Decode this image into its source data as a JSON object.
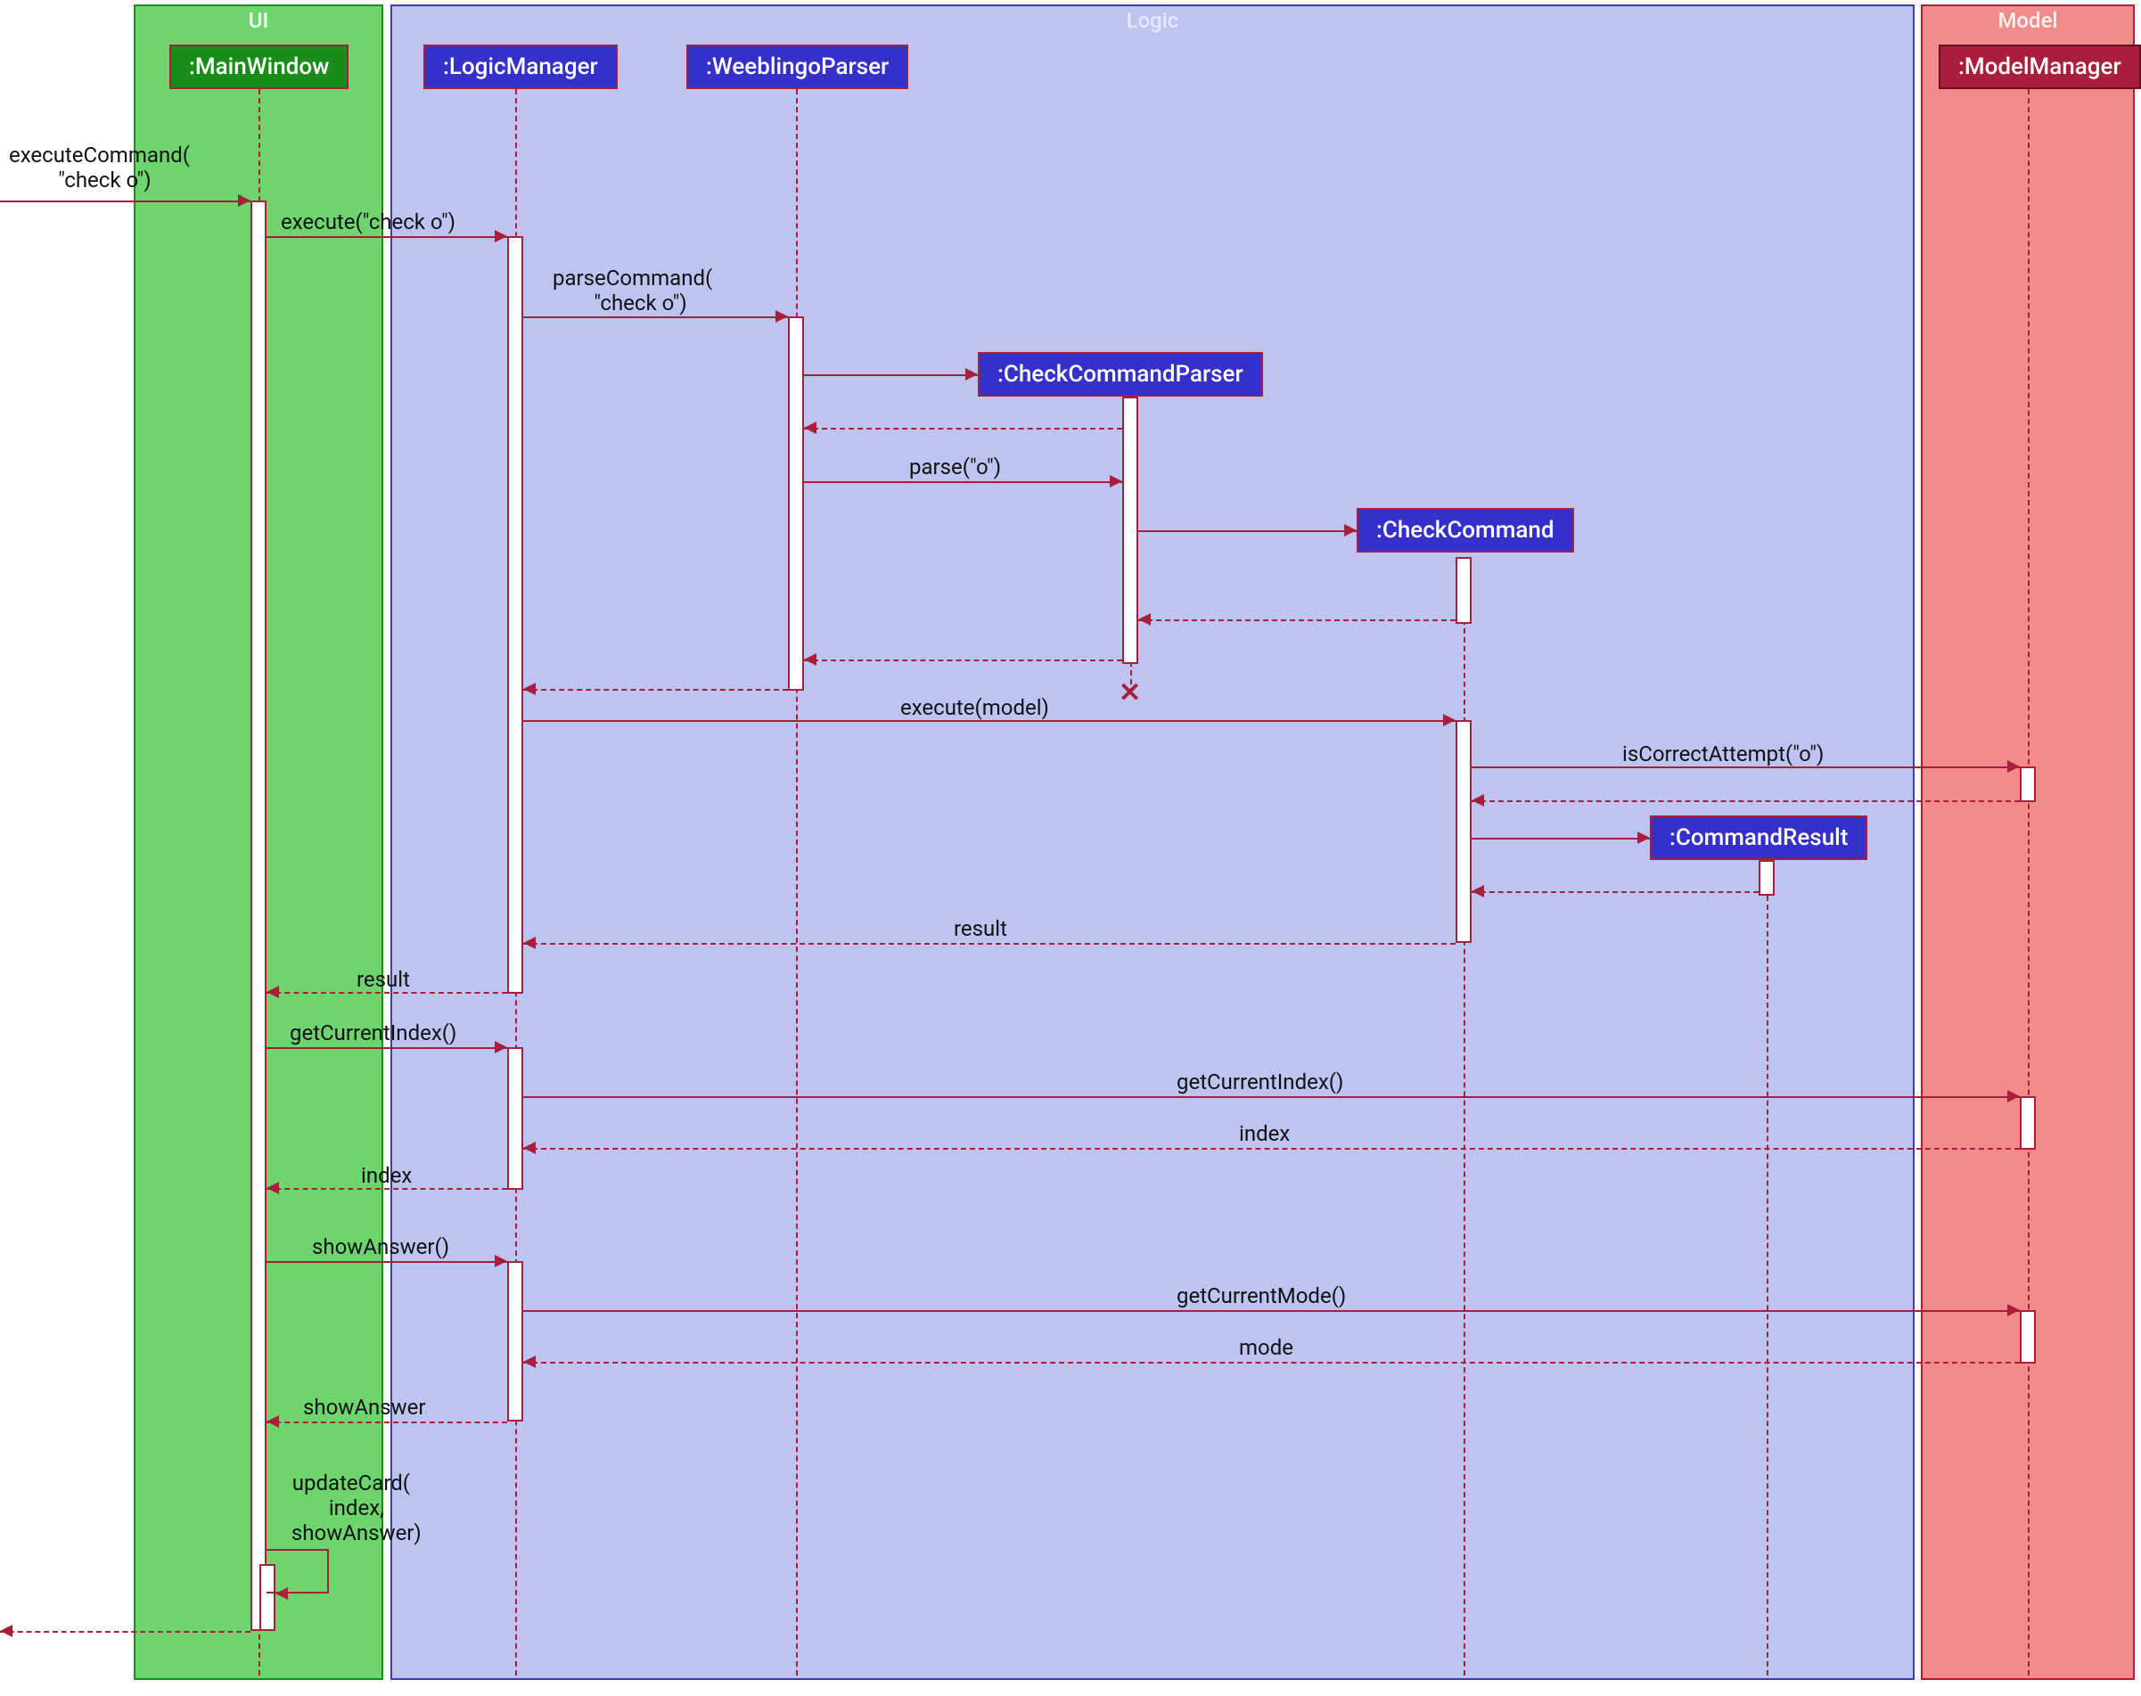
{
  "regions": {
    "ui": {
      "title": "UI",
      "bg": "#6ed46e",
      "border": "#1a8c1a",
      "titleColor": "#f0fff0"
    },
    "logic": {
      "title": "Logic",
      "bg": "#bdc4f2",
      "border": "#3c3fa7",
      "titleColor": "#e8e8ff"
    },
    "model": {
      "title": "Model",
      "bg": "#f28b8b",
      "border": "#a91e3a",
      "titleColor": "#fff0f0"
    }
  },
  "participants": {
    "mainWindow": {
      "label": ":MainWindow",
      "bg": "#1a8c1a",
      "border": "#a91e3a"
    },
    "logicManager": {
      "label": ":LogicManager",
      "bg": "#3530c9",
      "border": "#a91e3a"
    },
    "weeblingoParser": {
      "label": ":WeeblingoParser",
      "bg": "#3530c9",
      "border": "#a91e3a"
    },
    "checkCmdParser": {
      "label": ":CheckCommandParser",
      "bg": "#3530c9",
      "border": "#a91e3a"
    },
    "checkCommand": {
      "label": ":CheckCommand",
      "bg": "#3530c9",
      "border": "#a91e3a"
    },
    "commandResult": {
      "label": ":CommandResult",
      "bg": "#3530c9",
      "border": "#a91e3a"
    },
    "modelManager": {
      "label": ":ModelManager",
      "bg": "#a91e3a",
      "border": "#6b0f23"
    }
  },
  "messages": {
    "m1": "executeCommand(\n  \"check o\")",
    "m2": "execute(\"check o\")",
    "m3": "parseCommand(\n   \"check o\")",
    "m4": "parse(\"o\")",
    "m5": "execute(model)",
    "m6": "isCorrectAttempt(\"o\")",
    "m7": "result",
    "m8": "result",
    "m9": "getCurrentIndex()",
    "m10": "getCurrentIndex()",
    "m11": "index",
    "m12": "index",
    "m13": "showAnswer()",
    "m14": "getCurrentMode()",
    "m15": "mode",
    "m16": "showAnswer",
    "m17": "updateCard(\n  index,\n  showAnswer)"
  }
}
